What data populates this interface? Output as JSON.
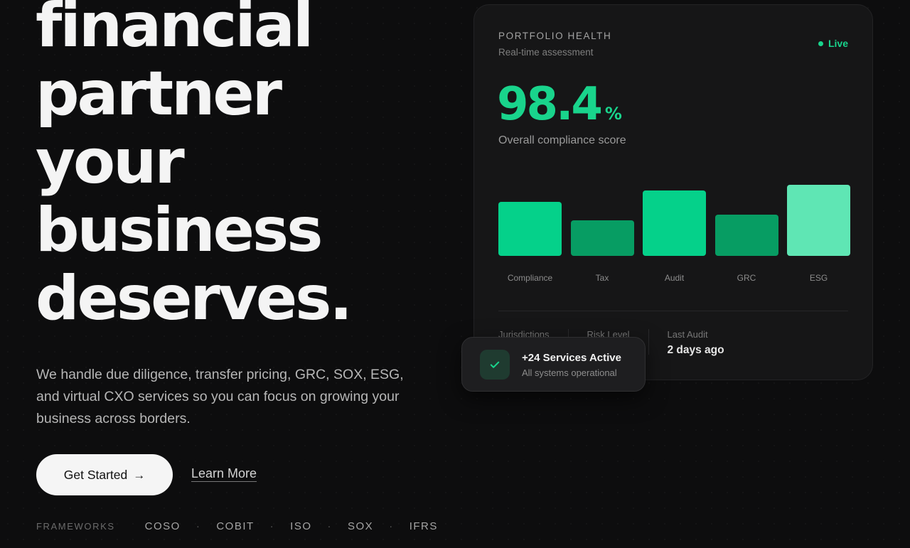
{
  "hero": {
    "headline_lines": [
      "financial",
      "partner",
      "your",
      "business",
      "deserves."
    ],
    "description": "We handle due diligence, transfer pricing, GRC, SOX, ESG, and virtual CXO services so you can focus on growing your business across borders.",
    "primary_button": "Get Started",
    "primary_button_icon": "arrow-right-icon",
    "secondary_button": "Learn More"
  },
  "frameworks": {
    "label": "FRAMEWORKS",
    "items": [
      "COSO",
      "COBIT",
      "ISO",
      "SOX",
      "IFRS"
    ],
    "separator": "·"
  },
  "card": {
    "title": "PORTFOLIO HEALTH",
    "subtitle": "Real-time assessment",
    "live_label": "Live",
    "score_value": "98.4",
    "score_unit": "%",
    "score_caption": "Overall compliance score",
    "stats": [
      {
        "label": "Jurisdictions",
        "value": ""
      },
      {
        "label": "Risk Level",
        "value": ""
      },
      {
        "label": "Last Audit",
        "value": "2 days ago"
      }
    ]
  },
  "chart_data": {
    "type": "bar",
    "categories": [
      "Compliance",
      "Tax",
      "Audit",
      "GRC",
      "ESG"
    ],
    "values": [
      76,
      50,
      92,
      58,
      100
    ],
    "ylim": [
      0,
      100
    ],
    "grid": false,
    "colors": [
      "#05d18a",
      "#079d63",
      "#05d18a",
      "#079d63",
      "#5fe6b4"
    ]
  },
  "toast": {
    "title": "+24 Services Active",
    "subtitle": "All systems operational",
    "icon": "check-icon"
  },
  "colors": {
    "accent": "#19d48c",
    "background": "#0d0d0e",
    "card": "#161617"
  }
}
